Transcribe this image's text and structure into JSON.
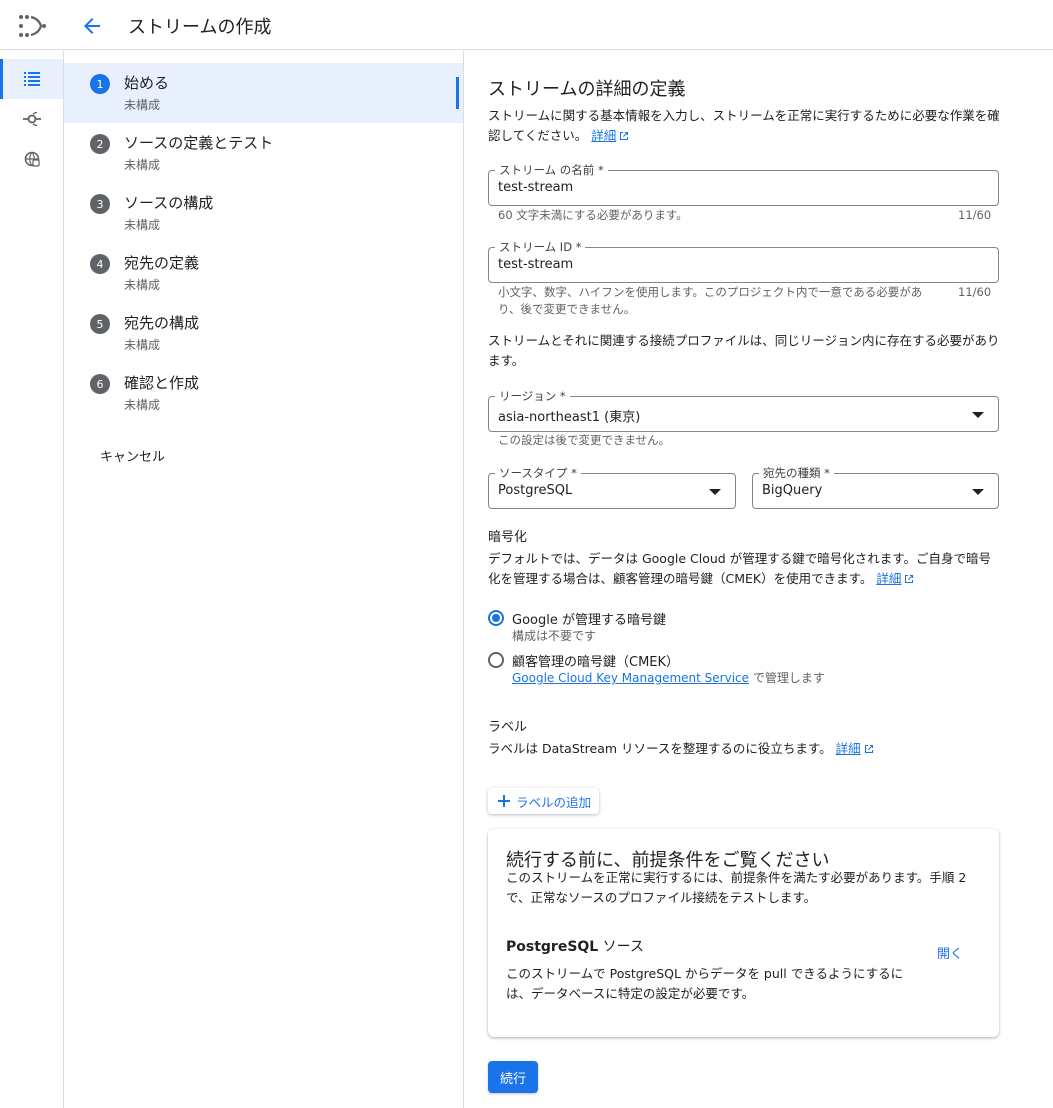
{
  "header": {
    "title": "ストリームの作成"
  },
  "nav_rail": {
    "items": [
      {
        "icon": "list-icon",
        "active": true
      },
      {
        "icon": "connection-icon",
        "active": false
      },
      {
        "icon": "globe-icon",
        "active": false
      }
    ]
  },
  "steps": [
    {
      "num": "1",
      "title": "始める",
      "status": "未構成",
      "active": true
    },
    {
      "num": "2",
      "title": "ソースの定義とテスト",
      "status": "未構成"
    },
    {
      "num": "3",
      "title": "ソースの構成",
      "status": "未構成"
    },
    {
      "num": "4",
      "title": "宛先の定義",
      "status": "未構成"
    },
    {
      "num": "5",
      "title": "宛先の構成",
      "status": "未構成"
    },
    {
      "num": "6",
      "title": "確認と作成",
      "status": "未構成"
    }
  ],
  "cancel_label": "キャンセル",
  "form": {
    "heading": "ストリームの詳細の定義",
    "intro": "ストリームに関する基本情報を入力し、ストリームを正常に実行するために必要な作業を確認してください。",
    "details_link": "詳細",
    "name_field": {
      "label": "ストリーム の名前 *",
      "value": "test-stream",
      "hint": "60 文字未満にする必要があります。",
      "counter": "11/60"
    },
    "id_field": {
      "label": "ストリーム ID *",
      "value": "test-stream",
      "hint": "小文字、数字、ハイフンを使用します。このプロジェクト内で一意である必要があり、後で変更できません。",
      "counter": "11/60"
    },
    "region_note": "ストリームとそれに関連する接続プロファイルは、同じリージョン内に存在する必要があります。",
    "region_field": {
      "label": "リージョン *",
      "value": "asia-northeast1 (東京)",
      "hint": "この設定は後で変更できません。"
    },
    "source_type": {
      "label": "ソースタイプ *",
      "value": "PostgreSQL"
    },
    "dest_type": {
      "label": "宛先の種類 *",
      "value": "BigQuery"
    },
    "encryption": {
      "heading": "暗号化",
      "desc": "デフォルトでは、データは Google Cloud が管理する鍵で暗号化されます。ご自身で暗号化を管理する場合は、顧客管理の暗号鍵（CMEK）を使用できます。",
      "details_link": "詳細",
      "opt1_label": "Google が管理する暗号鍵",
      "opt1_sub": "構成は不要です",
      "opt2_label": "顧客管理の暗号鍵（CMEK）",
      "opt2_link": "Google Cloud Key Management Service",
      "opt2_suffix": " で管理します",
      "selected": "opt1"
    },
    "labels": {
      "heading": "ラベル",
      "desc": "ラベルは DataStream リソースを整理するのに役立ちます。",
      "details_link": "詳細",
      "add_button": "ラベルの追加"
    },
    "prereq_card": {
      "title": "続行する前に、前提条件をご覧ください",
      "desc": "このストリームを正常に実行するには、前提条件を満たす必要があります。手順 2 で、正常なソースのプロファイル接続をテストします。",
      "sub_bold": "PostgreSQL",
      "sub_rest": " ソース",
      "open_label": "開く",
      "sub_desc": "このストリームで PostgreSQL からデータを pull できるようにするには、データベースに特定の設定が必要です。"
    },
    "continue_label": "続行"
  },
  "colors": {
    "accent": "#1a73e8",
    "border": "#dadce0",
    "active_bg": "#e8f0fe"
  }
}
